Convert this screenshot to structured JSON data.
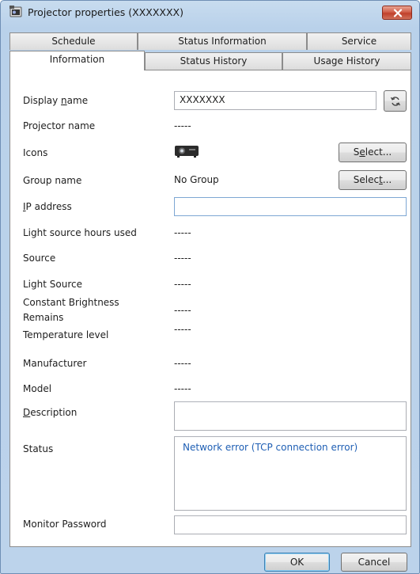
{
  "window": {
    "title": "Projector properties (XXXXXXX)",
    "close_glyph": "✕"
  },
  "tabs": {
    "row1": [
      "Schedule",
      "Status Information",
      "Service"
    ],
    "row2": [
      "Information",
      "Status History",
      "Usage History"
    ],
    "active": "Information"
  },
  "form": {
    "display_name": {
      "label_pre": "Display ",
      "label_key": "n",
      "label_post": "ame",
      "value": "XXXXXXX"
    },
    "projector_name": {
      "label": "Projector name",
      "value": "-----"
    },
    "icons": {
      "label": "Icons",
      "select_pre": "S",
      "select_key": "e",
      "select_post": "lect..."
    },
    "group_name": {
      "label": "Group name",
      "value": "No Group",
      "select_pre": "Selec",
      "select_key": "t",
      "select_post": "..."
    },
    "ip_address": {
      "label_key": "I",
      "label_post": "P address",
      "value": ""
    },
    "light_source_hours": {
      "label": "Light source hours used",
      "value": "-----"
    },
    "source": {
      "label": "Source",
      "value": "-----"
    },
    "light_source": {
      "label": "Light Source",
      "value": "-----"
    },
    "constant_brightness": {
      "label_line1": "Constant Brightness",
      "label_line2": "Remains",
      "value": "-----"
    },
    "temperature_level": {
      "label": "Temperature level",
      "value": "-----"
    },
    "manufacturer": {
      "label": "Manufacturer",
      "value": "-----"
    },
    "model": {
      "label": "Model",
      "value": "-----"
    },
    "description": {
      "label_key": "D",
      "label_post": "escription",
      "value": ""
    },
    "status": {
      "label": "Status",
      "value": "Network error (TCP connection error)"
    },
    "monitor_password": {
      "label": "Monitor Password",
      "value": ""
    }
  },
  "buttons": {
    "ok": "OK",
    "cancel": "Cancel"
  },
  "colors": {
    "status_text": "#1f5fb4",
    "accent_border": "#7ea7d3",
    "titlebar": "#b9d1ea"
  },
  "icons": [
    "projector-window-icon",
    "close-icon",
    "refresh-icon",
    "projector-icon"
  ]
}
